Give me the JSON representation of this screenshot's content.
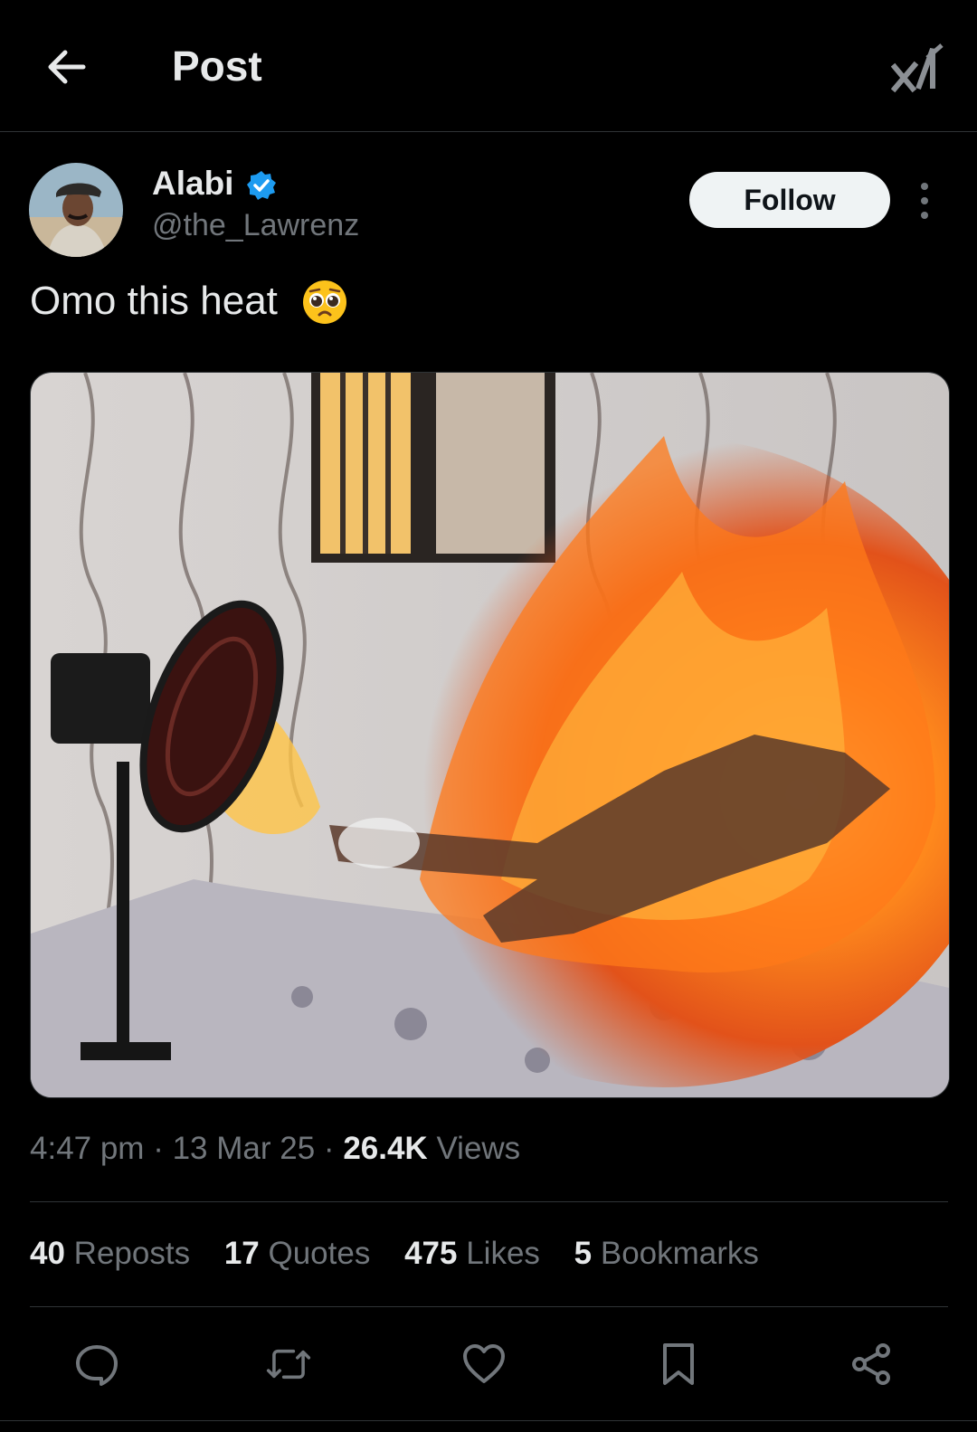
{
  "header": {
    "title": "Post",
    "back_icon": "arrow-left-icon",
    "logo_icon": "x-logo-icon"
  },
  "author": {
    "name": "Alabi",
    "handle": "@the_Lawrenz",
    "verified": true,
    "follow_label": "Follow"
  },
  "post": {
    "text": "Omo this heat",
    "emoji": "pleading-face"
  },
  "meta": {
    "time": "4:47 pm",
    "date": "13 Mar 25",
    "views_count": "26.4K",
    "views_label": "Views",
    "separator": "·"
  },
  "stats": [
    {
      "count": "40",
      "label": "Reposts"
    },
    {
      "count": "17",
      "label": "Quotes"
    },
    {
      "count": "475",
      "label": "Likes"
    },
    {
      "count": "5",
      "label": "Bookmarks"
    }
  ],
  "actions": [
    "reply-icon",
    "repost-icon",
    "like-icon",
    "bookmark-icon",
    "share-icon"
  ],
  "colors": {
    "background": "#000000",
    "text": "#e7e9ea",
    "secondary": "#71767b",
    "verified": "#1d9bf0",
    "divider": "#2f3336"
  }
}
